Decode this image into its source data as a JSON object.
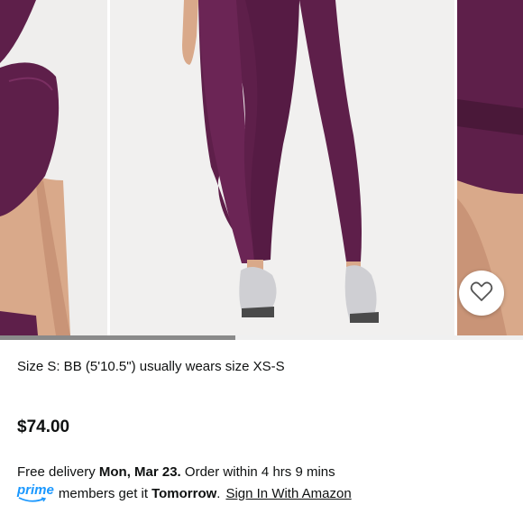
{
  "gallery": {
    "images": [
      {
        "name": "product-photo-detail-top"
      },
      {
        "name": "product-photo-full-leggings"
      },
      {
        "name": "product-photo-detail-waistband"
      }
    ],
    "wishlist_icon": "heart-outline-icon",
    "scroll_progress": 0.45
  },
  "product": {
    "size_note": "Size S: BB (5'10.5\") usually wears size XS-S",
    "price": "$74.00"
  },
  "delivery": {
    "prefix": "Free delivery",
    "date": "Mon, Mar 23.",
    "suffix": "Order within 4 hrs 9 mins",
    "prime_label": "prime",
    "prime_text": "members get it",
    "prime_day": "Tomorrow",
    "period": ".",
    "signin_link": "Sign In With Amazon"
  },
  "colors": {
    "garment": "#5e1f4a",
    "prime_blue": "#1a98ff",
    "background": "#f1f0ef"
  }
}
